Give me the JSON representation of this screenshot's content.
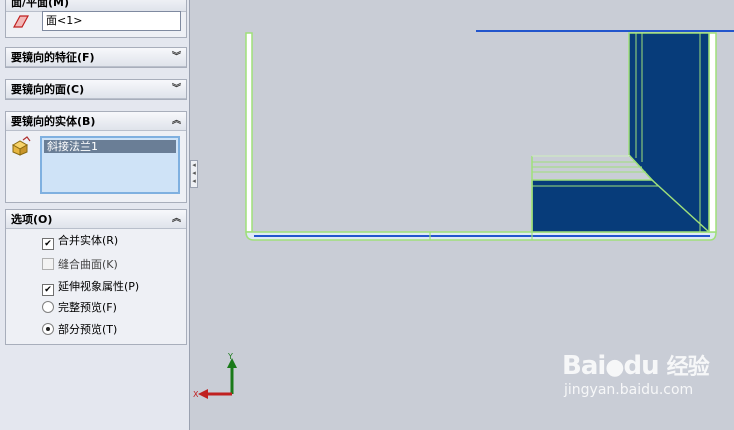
{
  "panel": {
    "top_group": {
      "title": "面/平面(M)",
      "field_value": "面<1>",
      "icon": "plane-face-icon"
    },
    "features_group": {
      "title": "要镜向的特征(F)",
      "chevron": "double-chevron-down"
    },
    "faces_group": {
      "title": "要镜向的面(C)",
      "chevron": "double-chevron-down"
    },
    "bodies_group": {
      "title": "要镜向的实体(B)",
      "chevron": "double-chevron-up",
      "icon": "solid-body-icon",
      "items": [
        "斜接法兰1"
      ]
    },
    "options_group": {
      "title": "选项(O)",
      "chevron": "double-chevron-up",
      "options": [
        {
          "label": "合并实体(R)",
          "kind": "checkbox",
          "checked": true,
          "enabled": true
        },
        {
          "label": "缝合曲面(K)",
          "kind": "checkbox",
          "checked": false,
          "enabled": false
        },
        {
          "label": "延伸视象属性(P)",
          "kind": "checkbox",
          "checked": true,
          "enabled": true
        },
        {
          "label": "完整预览(F)",
          "kind": "radio",
          "checked": false,
          "enabled": true
        },
        {
          "label": "部分预览(T)",
          "kind": "radio",
          "checked": true,
          "enabled": true
        }
      ]
    }
  },
  "triad": {
    "x_label": "X",
    "y_label": "Y"
  },
  "watermark": {
    "brand": "Bai",
    "brand_suffix": "du",
    "cn": "经验",
    "url": "jingyan.baidu.com"
  },
  "colors": {
    "model_fill": "#073c7a",
    "edge_highlight": "#9fe07a",
    "edge_blue": "#2255cc",
    "background": "#c9cdd6"
  }
}
